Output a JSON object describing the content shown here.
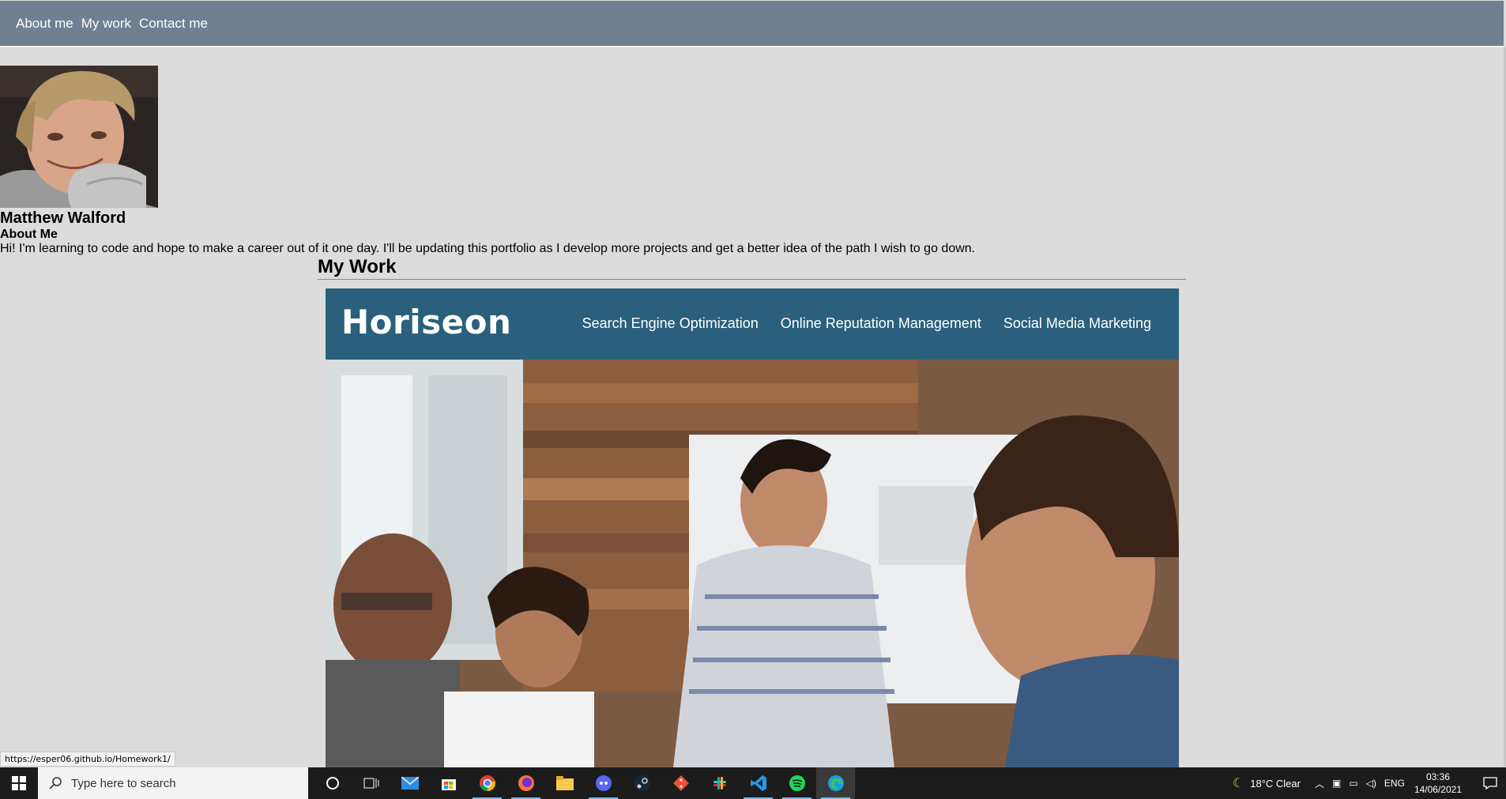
{
  "nav": {
    "links": [
      "About me",
      "My work",
      "Contact me"
    ]
  },
  "profile": {
    "photo_alt": "Matthew Walford",
    "name": "Matthew Walford",
    "about_heading": "About Me",
    "about_text": "Hi! I'm learning to code and hope to make a career out of it one day. I'll be updating this portfolio as I develop more projects and get a better idea of the path I wish to go down."
  },
  "work": {
    "heading": "My Work",
    "project": {
      "logo": "Horiseon",
      "links": [
        "Search Engine Optimization",
        "Online Reputation Management",
        "Social Media Marketing"
      ]
    }
  },
  "status_url": "https://esper06.github.io/Homework1/",
  "taskbar": {
    "search_placeholder": "Type here to search",
    "apps": [
      "cortana-icon",
      "task-view-icon",
      "mail-icon",
      "store-icon",
      "chrome-icon",
      "firefox-icon",
      "file-explorer-icon",
      "discord-icon",
      "steam-icon",
      "git-icon",
      "slack-icon",
      "vscode-icon",
      "spotify-icon",
      "edge-icon"
    ],
    "weather": "18°C  Clear",
    "language": "ENG",
    "time": "03:36",
    "date": "14/06/2021"
  },
  "colors": {
    "nav_bg": "#708090",
    "page_bg": "#dcdcdc",
    "project_header_bg": "#2a607c",
    "taskbar_bg": "#1c1c1c"
  }
}
